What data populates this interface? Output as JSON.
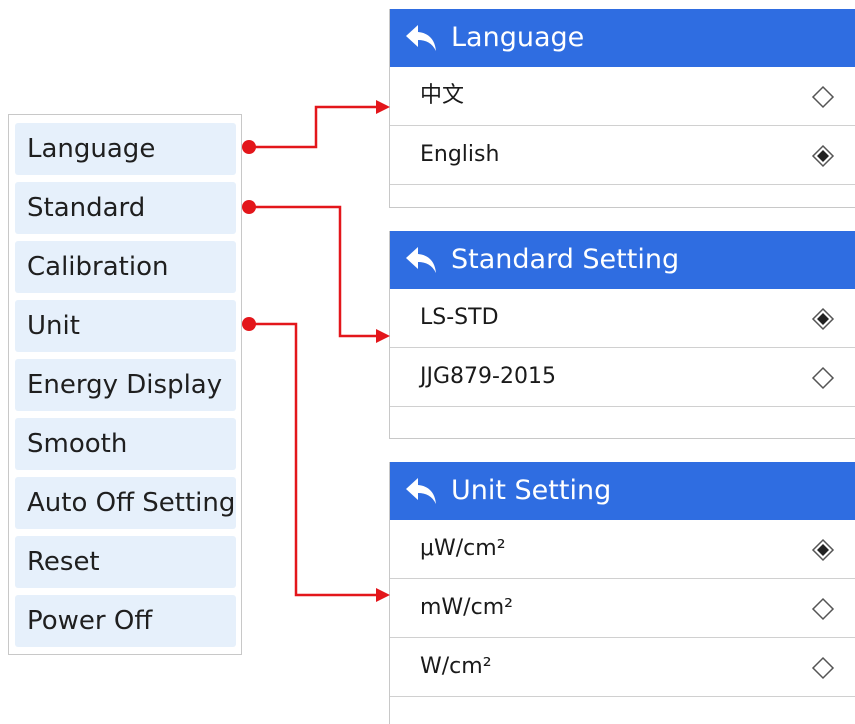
{
  "menu": {
    "items": [
      {
        "label": "Language"
      },
      {
        "label": "Standard"
      },
      {
        "label": "Calibration"
      },
      {
        "label": "Unit"
      },
      {
        "label": "Energy Display"
      },
      {
        "label": "Smooth"
      },
      {
        "label": "Auto Off Setting"
      },
      {
        "label": "Reset"
      },
      {
        "label": "Power Off"
      }
    ]
  },
  "panels": {
    "language": {
      "title": "Language",
      "options": [
        {
          "label": "中文",
          "selected": false
        },
        {
          "label": "English",
          "selected": true
        }
      ]
    },
    "standard": {
      "title": "Standard Setting",
      "options": [
        {
          "label": "LS-STD",
          "selected": true
        },
        {
          "label": "JJG879-2015",
          "selected": false
        }
      ]
    },
    "unit": {
      "title": "Unit Setting",
      "options": [
        {
          "label": "μW/cm²",
          "selected": true
        },
        {
          "label": "mW/cm²",
          "selected": false
        },
        {
          "label": "W/cm²",
          "selected": false
        }
      ]
    }
  },
  "colors": {
    "header": "#2f6de1",
    "menu_item_bg": "#e6f0fb",
    "connector": "#e3161b"
  },
  "icons": {
    "back": "back-arrow-icon",
    "radio_selected": "radio-selected-icon",
    "radio_unselected": "radio-unselected-icon"
  }
}
